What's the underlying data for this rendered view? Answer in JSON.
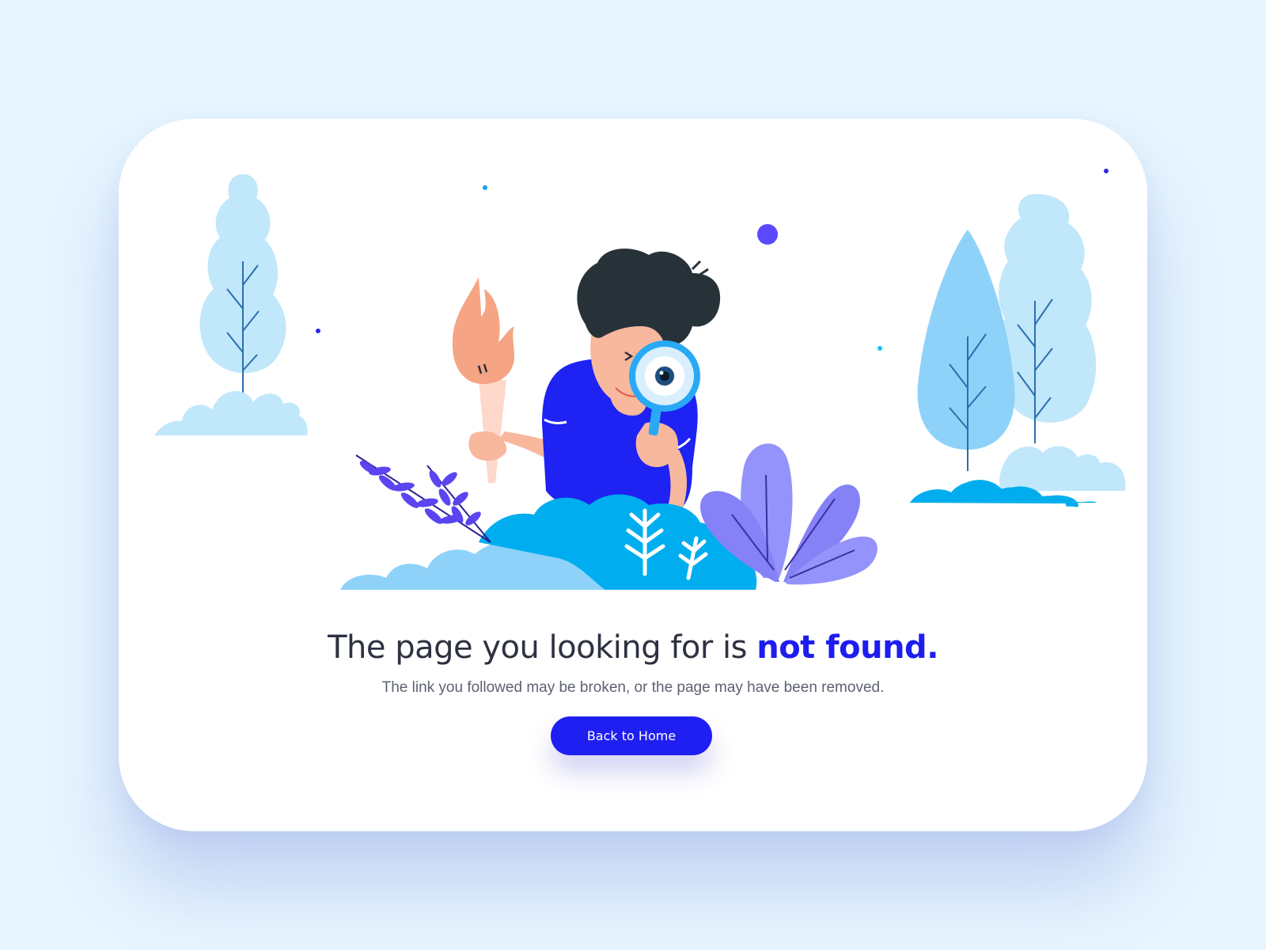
{
  "error_page": {
    "headline_main": "The page you looking for is ",
    "headline_accent": "not found.",
    "subtext": "The link you followed may be broken, or the page may have been removed.",
    "button_label": "Back to Home"
  },
  "illustration": {
    "subject": "person-with-magnifying-glass-and-torch",
    "icons": [
      "tree-icon",
      "bush-icon",
      "leaf-icon",
      "torch-icon",
      "magnifying-glass-icon"
    ]
  },
  "colors": {
    "background": "#e6f5fe",
    "card": "#ffffff",
    "accent": "#1d1df0",
    "button": "#1f1ff2",
    "headline_text": "#2e3140",
    "subtext": "#5d6270"
  }
}
